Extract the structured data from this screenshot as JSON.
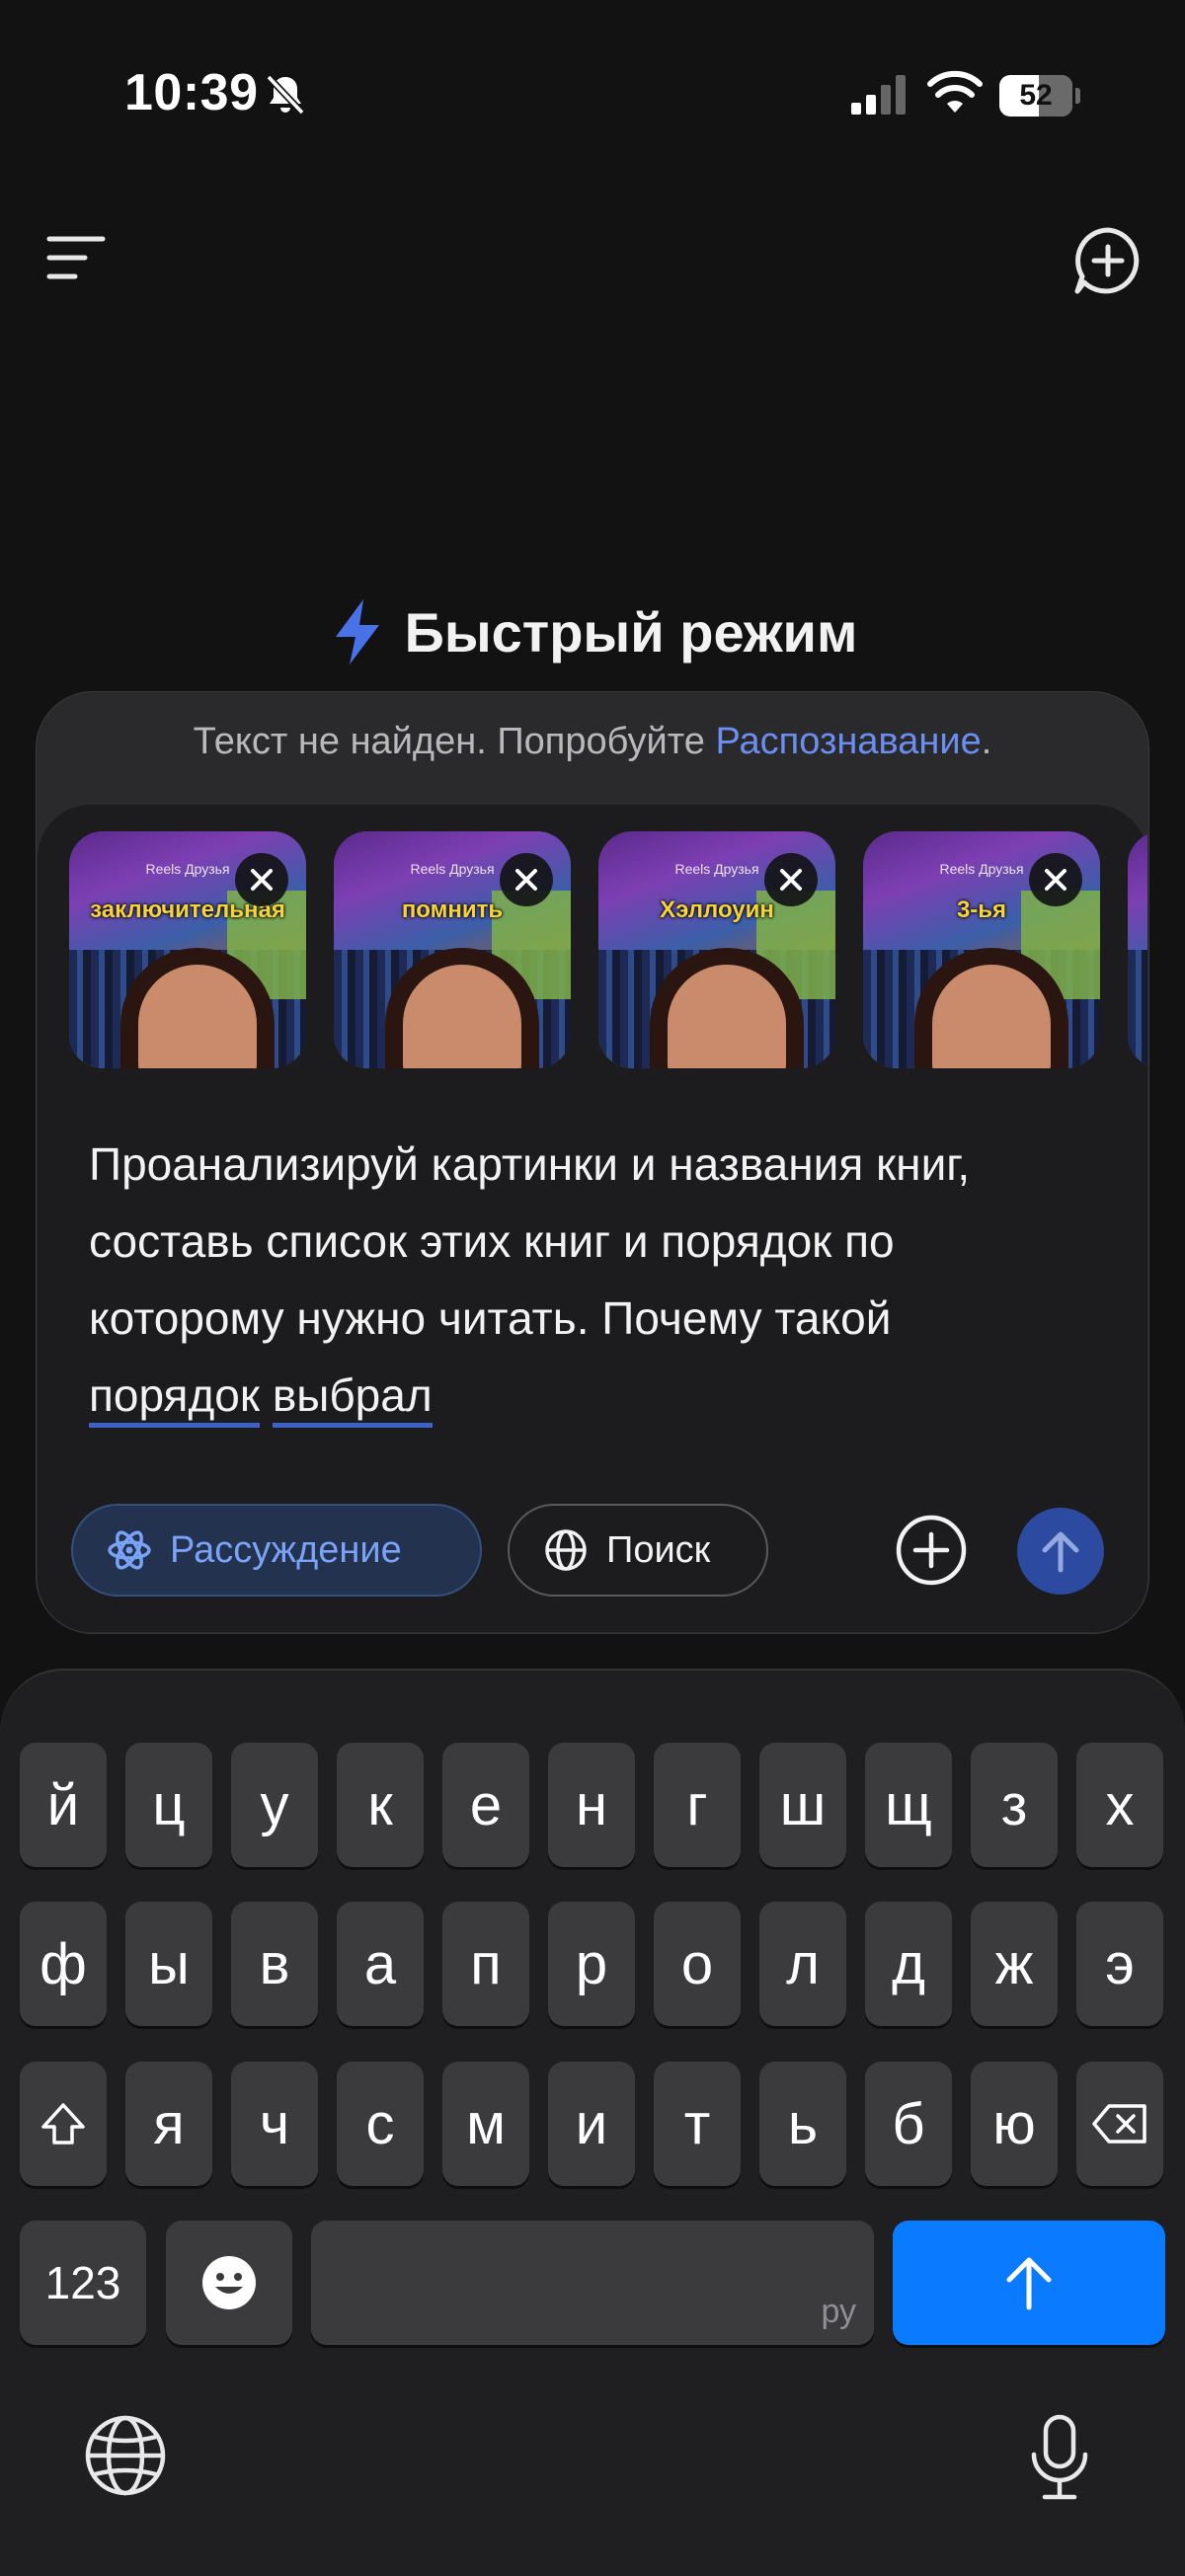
{
  "status_bar": {
    "time": "10:39",
    "battery": "52"
  },
  "header": {
    "mode_title": "Быстрый режим"
  },
  "notice": {
    "text": "Текст не найден. Попробуйте ",
    "link": "Распознавание",
    "end": "."
  },
  "attachments": [
    {
      "caption": "заключительная",
      "topbar": "Reels  Друзья"
    },
    {
      "caption": "помнить",
      "topbar": "Reels  Друзья"
    },
    {
      "caption": "Хэллоуин",
      "topbar": "Reels  Друзья"
    },
    {
      "caption": "3-ья",
      "topbar": "Reels  Друзья"
    }
  ],
  "prompt": {
    "line1": "Проанализируй картинки и названия книг,",
    "line2": "составь список этих книг и порядок по",
    "line3": "которому нужно читать. Почему такой",
    "word1": "порядок",
    "word2": "выбрал"
  },
  "toolbar": {
    "reasoning_label": "Рассуждение",
    "search_label": "Поиск"
  },
  "keyboard": {
    "row1": [
      "й",
      "ц",
      "у",
      "к",
      "е",
      "н",
      "г",
      "ш",
      "щ",
      "з",
      "х"
    ],
    "row2": [
      "ф",
      "ы",
      "в",
      "а",
      "п",
      "р",
      "о",
      "л",
      "д",
      "ж",
      "э"
    ],
    "row3": [
      "я",
      "ч",
      "с",
      "м",
      "и",
      "т",
      "ь",
      "б",
      "ю"
    ],
    "numbers_label": "123",
    "space_language": "ру"
  },
  "colors": {
    "accent": "#6b8ff0",
    "return_key": "#0a7aff",
    "send_button": "#2c4aa0"
  }
}
